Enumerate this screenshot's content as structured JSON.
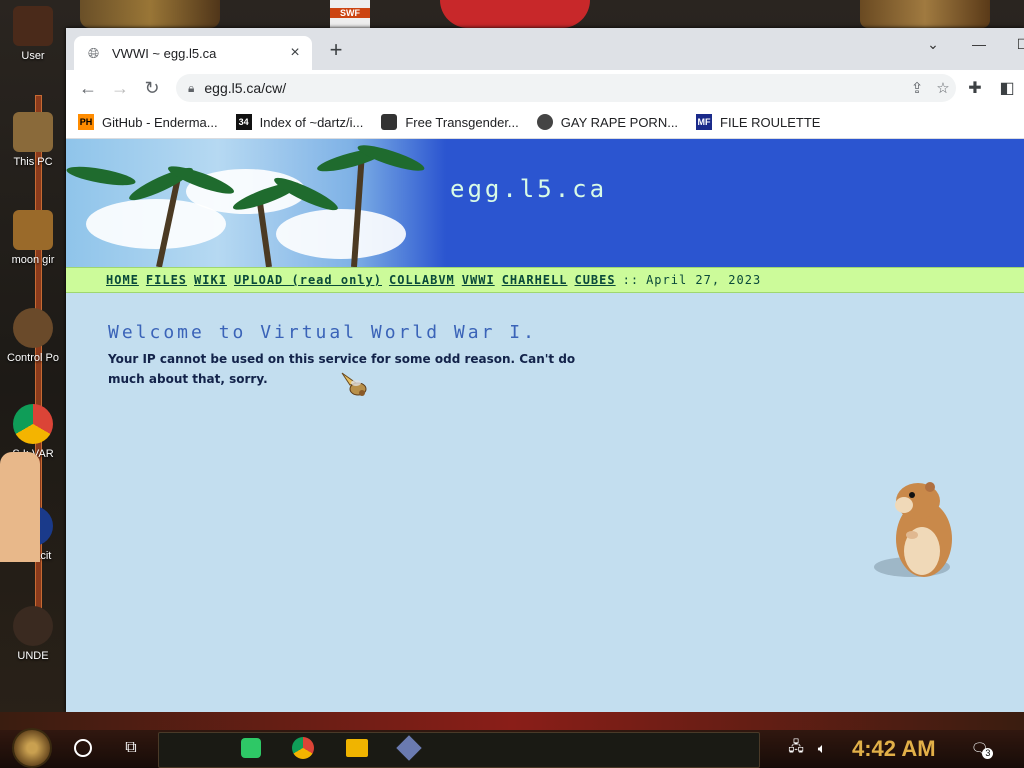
{
  "desktop": {
    "icons": [
      {
        "label": "User"
      },
      {
        "label": "This PC"
      },
      {
        "label": "moon gir"
      },
      {
        "label": "Control Po"
      },
      {
        "label": "S I: VAR"
      },
      {
        "label": "Audacit"
      },
      {
        "label": "UNDE"
      }
    ]
  },
  "browser": {
    "tab": {
      "title": "VWWI ~ egg.l5.ca",
      "close": "×"
    },
    "new_tab": "+",
    "address": {
      "url": "egg.l5.ca/cw/"
    },
    "bookmarks": [
      {
        "label": "GitHub - Enderma...",
        "icon_text": "PH",
        "icon_color": "#ff8c00"
      },
      {
        "label": "Index of ~dartz/i...",
        "icon_text": "34",
        "icon_color": "#111111"
      },
      {
        "label": "Free Transgender...",
        "icon_text": "",
        "icon_color": "#333333"
      },
      {
        "label": "GAY RAPE PORN...",
        "icon_text": "",
        "icon_color": "#444444"
      },
      {
        "label": "FILE ROULETTE",
        "icon_text": "MF",
        "icon_color": "#1a2a8a"
      }
    ]
  },
  "page": {
    "site_title": "egg.l5.ca",
    "nav": [
      "HOME",
      "FILES",
      "WIKI",
      "UPLOAD (read only)",
      "COLLABVM",
      "VWWI",
      "CHARHELL",
      "CUBES"
    ],
    "nav_sep": "::",
    "date": "April 27, 2023",
    "headline": "Welcome to Virtual World War I.",
    "message": "Your IP cannot be used on this service for some odd reason. Can't do much about that, sorry."
  },
  "taskbar": {
    "clock": "4:42 AM",
    "notification_count": "3",
    "apps": [
      "start-orb",
      "search-circle",
      "task-view",
      "notes",
      "chrome",
      "file-explorer",
      "virtualbox"
    ]
  },
  "colors": {
    "page_bg": "#c3deef",
    "banner": "#2b55d0",
    "nav_strip": "#ccfb9a",
    "headline": "#3a63b8",
    "clock": "#e2b048"
  }
}
